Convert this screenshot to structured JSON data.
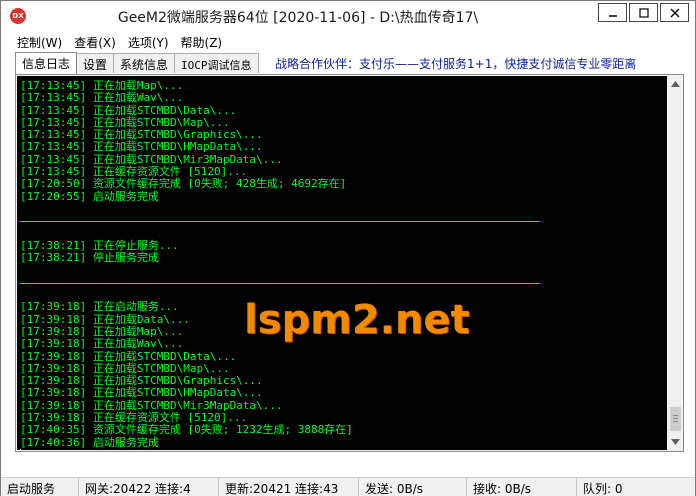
{
  "window": {
    "title": "GeeM2微端服务器64位 [2020-11-06] - D:\\热血传奇17\\",
    "icon_label": "DX",
    "buttons": [
      "minimize",
      "maximize",
      "close"
    ]
  },
  "menu": {
    "items": [
      "控制(W)",
      "查看(X)",
      "选项(Y)",
      "帮助(Z)"
    ]
  },
  "tabs": {
    "items": [
      "信息日志",
      "设置",
      "系统信息",
      "IOCP调试信息"
    ],
    "active_index": 0
  },
  "notice": "战略合作伙伴：支付乐——支付服务1+1，快捷支付诚信专业零距离",
  "watermark": "lspm2.net",
  "log": {
    "lines": [
      "[17:13:45] 正在加载Map\\...",
      "[17:13:45] 正在加载Wav\\...",
      "[17:13:45] 正在加载STCMBD\\Data\\...",
      "[17:13:45] 正在加载STCMBD\\Map\\...",
      "[17:13:45] 正在加载STCMBD\\Graphics\\...",
      "[17:13:45] 正在加载STCMBD\\HMapData\\...",
      "[17:13:45] 正在加载STCMBD\\Mir3MapData\\...",
      "[17:13:45] 正在缓存资源文件 [5120]...",
      "[17:20:50] 资源文件缓存完成 [0失败; 428生成; 4692存在]",
      "[17:20:55] 启动服务完成",
      "",
      "---",
      "",
      "[17:38:21] 正在停止服务...",
      "[17:38:21] 停止服务完成",
      "",
      "---",
      "",
      "[17:39:18] 正在启动服务...",
      "[17:39:18] 正在加载Data\\...",
      "[17:39:18] 正在加载Map\\...",
      "[17:39:18] 正在加载Wav\\...",
      "[17:39:18] 正在加载STCMBD\\Data\\...",
      "[17:39:18] 正在加载STCMBD\\Map\\...",
      "[17:39:18] 正在加载STCMBD\\Graphics\\...",
      "[17:39:18] 正在加载STCMBD\\HMapData\\...",
      "[17:39:18] 正在加载STCMBD\\Mir3MapData\\...",
      "[17:39:18] 正在缓存资源文件 [5120]...",
      "[17:40:35] 资源文件缓存完成 [0失败; 1232生成; 3888存在]",
      "[17:40:36] 启动服务完成"
    ]
  },
  "status": {
    "cells": [
      "启动服务",
      "网关:20422  连接:4",
      "更新:20421  连接:43",
      "发送: 0B/s",
      "接收: 0B/s",
      "队列: 0"
    ]
  },
  "colors": {
    "log_text": "#00ff24",
    "log_bg": "#000000",
    "notice": "#0b1f9e",
    "watermark": "#f28a00"
  }
}
